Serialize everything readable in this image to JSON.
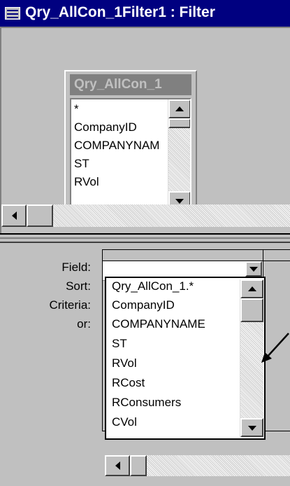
{
  "window": {
    "title": "Qry_AllCon_1Filter1 : Filter"
  },
  "table": {
    "name": "Qry_AllCon_1",
    "fields": [
      "*",
      "CompanyID",
      "COMPANYNAM",
      "ST",
      "RVol"
    ]
  },
  "grid": {
    "row_labels": [
      "Field:",
      "Sort:",
      "Criteria:",
      "or:"
    ],
    "field_value": ""
  },
  "dropdown": {
    "options": [
      "Qry_AllCon_1.*",
      "CompanyID",
      "COMPANYNAME",
      "ST",
      "RVol",
      "RCost",
      "RConsumers",
      "CVol"
    ]
  },
  "icons": {
    "title": "query-window-icon",
    "scroll_up": "arrow-up-icon",
    "scroll_down": "arrow-down-icon",
    "scroll_left": "arrow-left-icon",
    "annotation": "pointer-arrow-icon"
  }
}
